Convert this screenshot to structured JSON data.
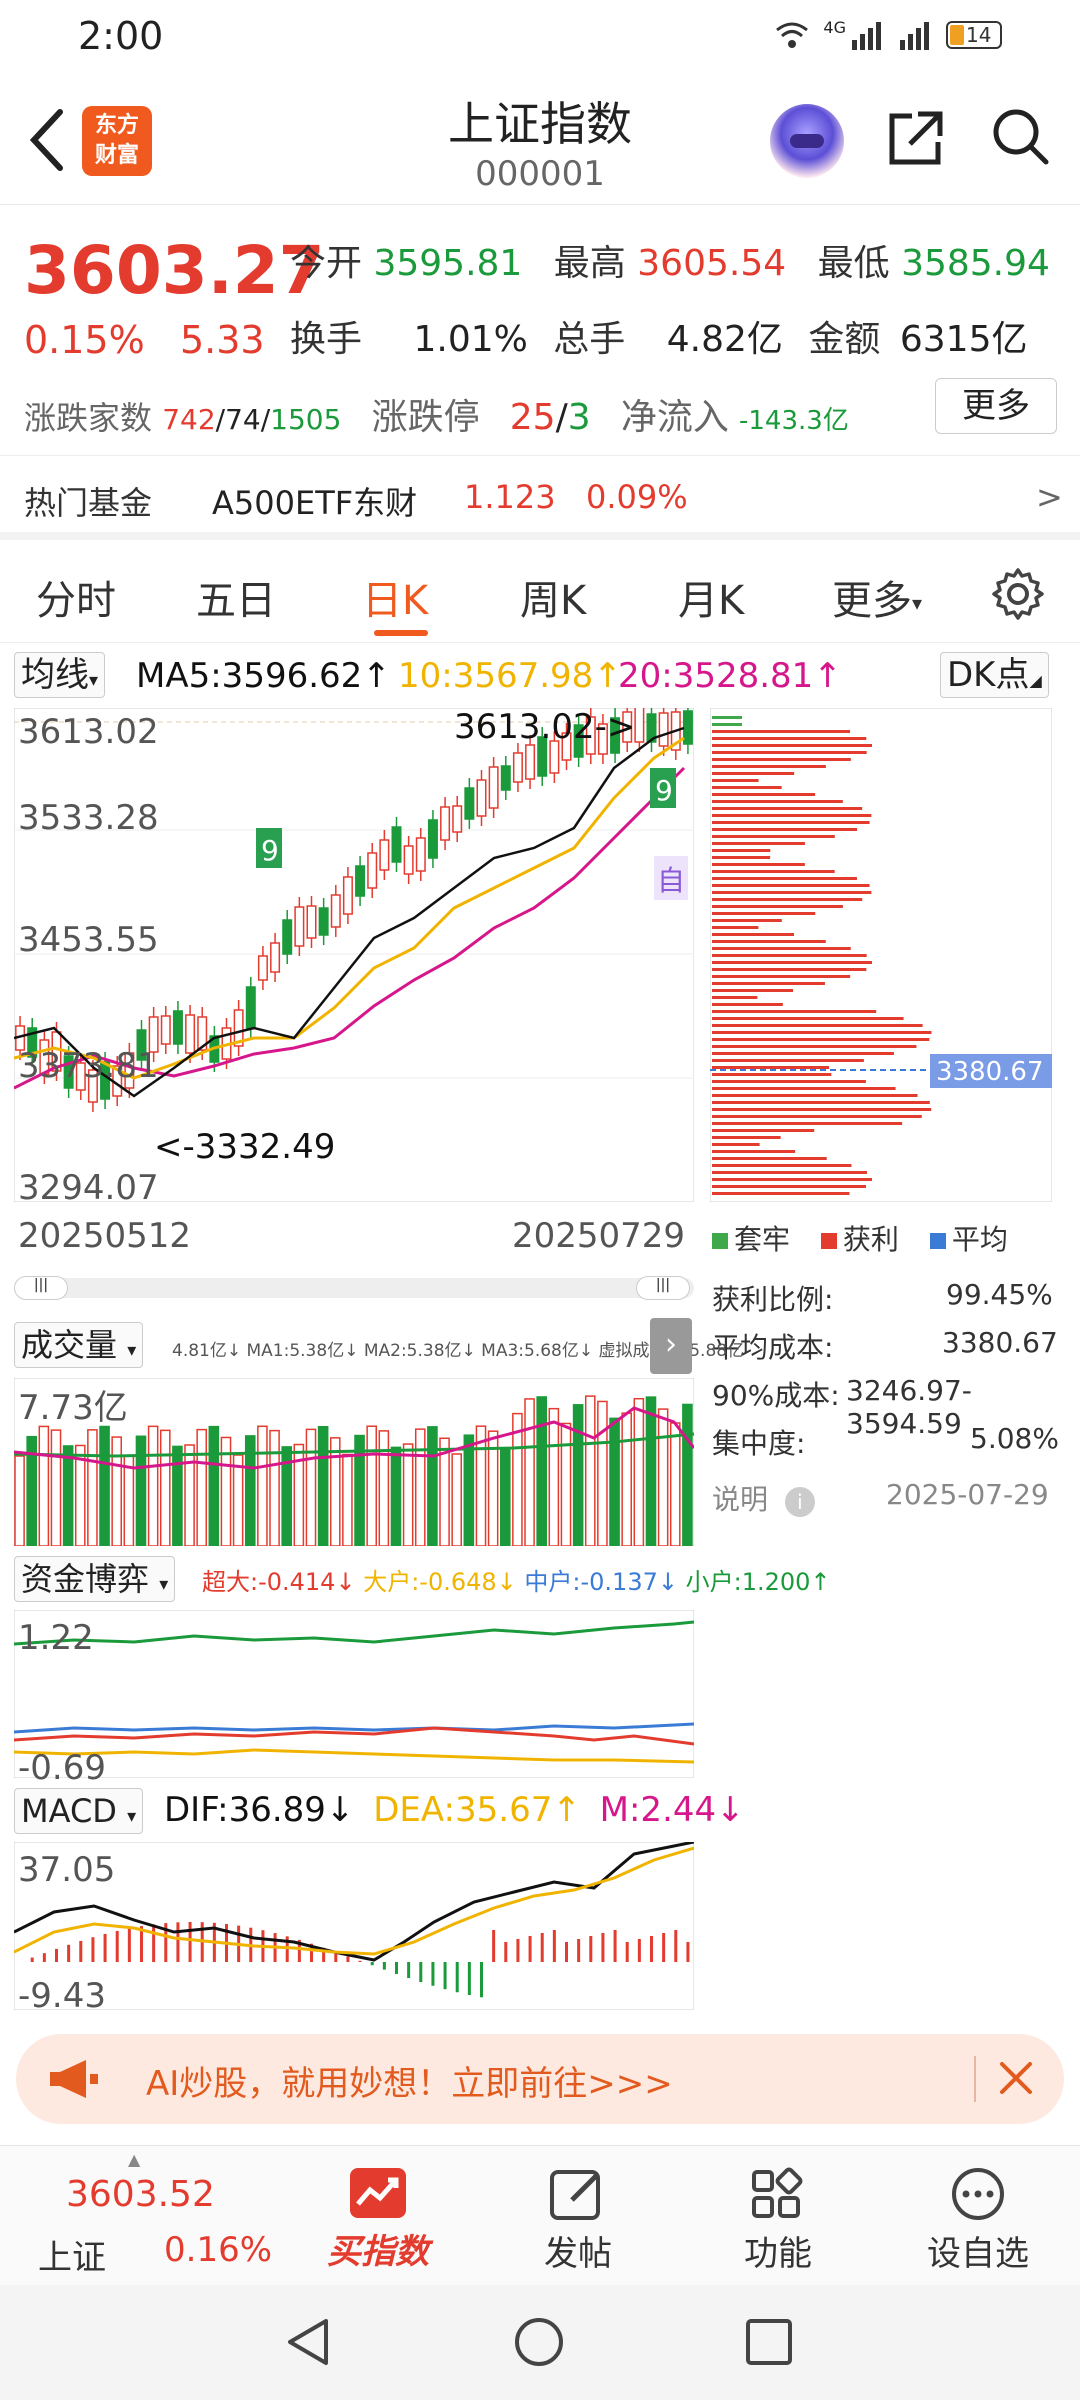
{
  "status_bar": {
    "time": "2:00",
    "signal_label": "4G",
    "battery": "14"
  },
  "header": {
    "title": "上证指数",
    "code": "000001",
    "logo_line1": "东方",
    "logo_line2": "财富"
  },
  "quote": {
    "price": "3603.27",
    "change_pct": "0.15%",
    "change": "5.33",
    "open_label": "今开",
    "open": "3595.81",
    "high_label": "最高",
    "high": "3605.54",
    "low_label": "最低",
    "low": "3585.94",
    "turnover_label": "换手",
    "turnover": "1.01%",
    "volume_label": "总手",
    "volume": "4.82亿",
    "amount_label": "金额",
    "amount": "6315亿",
    "breadth_label": "涨跌家数",
    "breadth_up": "742",
    "breadth_flat": "74",
    "breadth_down": "1505",
    "limit_label": "涨跌停",
    "limit_up": "25",
    "limit_down": "3",
    "netflow_label": "净流入",
    "netflow": "-143.3亿",
    "more": "更多"
  },
  "hot_fund": {
    "label": "热门基金",
    "name": "A500ETF东财",
    "price": "1.123",
    "pct": "0.09%",
    "arrow": ">"
  },
  "tabs": [
    {
      "label": "分时"
    },
    {
      "label": "五日"
    },
    {
      "label": "日K"
    },
    {
      "label": "周K"
    },
    {
      "label": "月K"
    },
    {
      "label": "更多"
    }
  ],
  "ma_legend": {
    "selector": "均线",
    "ma5": "MA5:3596.62↑",
    "ma10": "10:3567.98↑",
    "ma20": "20:3528.81↑",
    "dk": "DK点"
  },
  "kline": {
    "y_labels": [
      "3613.02",
      "3533.28",
      "3453.55",
      "3373.81",
      "3294.07"
    ],
    "start_date": "20250512",
    "end_date": "20250729",
    "max_marker": "3613.02->",
    "min_marker": "<-3332.49",
    "nine_marker": "9",
    "zi_marker": "自",
    "chip_price": "3380.67"
  },
  "chip_legend": {
    "trapped": "套牢",
    "profit": "获利",
    "avg": "平均"
  },
  "chip_stats": {
    "profit_ratio_label": "获利比例:",
    "profit_ratio": "99.45%",
    "avg_cost_label": "平均成本:",
    "avg_cost": "3380.67",
    "cost90_label": "90%成本:",
    "cost90": "3246.97-3594.59",
    "concentration_label": "集中度:",
    "concentration": "5.08%",
    "note_label": "说明",
    "date": "2025-07-29"
  },
  "volume_panel": {
    "selector": "成交量",
    "legend": "4.81亿↓ MA1:5.38亿↓ MA2:5.38亿↓ MA3:5.68亿↓ 虚拟成交量:5.88亿",
    "max": "7.73亿"
  },
  "fund_panel": {
    "selector": "资金博弈",
    "super": "超大:-0.414↓",
    "big": "大户:-0.648↓",
    "mid": "中户:-0.137↓",
    "small": "小户:1.200↑",
    "max": "1.22",
    "min": "-0.69"
  },
  "macd_panel": {
    "selector": "MACD",
    "dif": "DIF:36.89↓",
    "dea": "DEA:35.67↑",
    "m": "M:2.44↓",
    "max": "37.05",
    "min": "-9.43"
  },
  "banner": {
    "text": "AI炒股，就用妙想！立即前往>>>"
  },
  "bottom_bar": {
    "index_price": "3603.52",
    "index_name": "上证",
    "index_pct": "0.16%",
    "buy": "买指数",
    "post": "发帖",
    "function": "功能",
    "watch": "设自选"
  },
  "colors": {
    "red": "#e33b2e",
    "green": "#1a9a3a",
    "orange": "#f05a1e",
    "ma5": "#111111",
    "ma10": "#f0b400",
    "ma20": "#d6168b"
  }
}
